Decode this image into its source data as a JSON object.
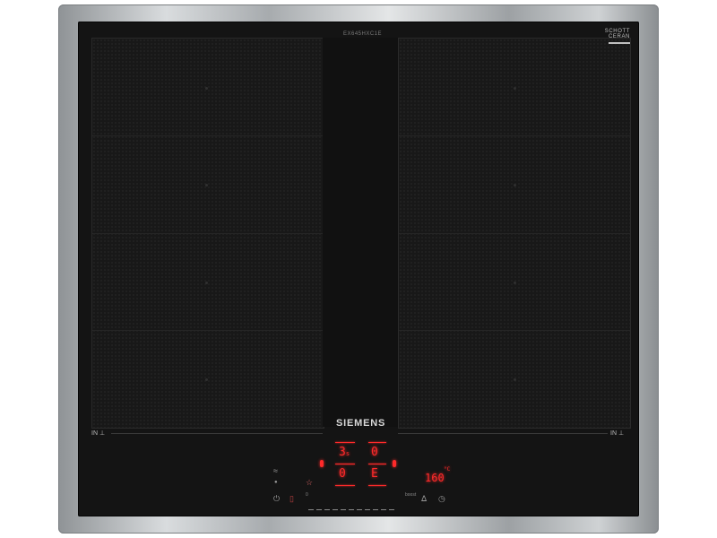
{
  "brand": "SIEMENS",
  "glass_maker": [
    "SCHOTT",
    "CERAN"
  ],
  "model_code": "EX645HXC1E",
  "zones": [
    {
      "id": "left",
      "label": "IN",
      "icon": "flex-zone-icon"
    },
    {
      "id": "right",
      "label": "IN",
      "icon": "flex-zone-icon"
    }
  ],
  "display": {
    "power_level": "3",
    "power_suffix": "s",
    "rear_level": "0",
    "front_level": "0",
    "frying_level": "E",
    "frying_temp": "160",
    "temp_unit": "°C"
  },
  "slider": {
    "min_label": "0",
    "max_label": "boost"
  },
  "icons": [
    "power-icon",
    "lock-icon",
    "favourite-icon",
    "wifi-icon",
    "frying-sensor-icon",
    "timer-icon"
  ]
}
